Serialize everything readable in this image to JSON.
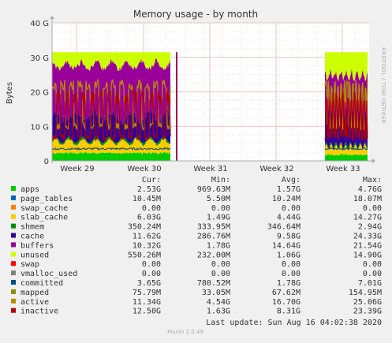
{
  "chart_data": {
    "type": "area",
    "title": "Memory usage - by month",
    "ylabel": "Bytes",
    "ylim": [
      0,
      40
    ],
    "y_unit": "G",
    "yticks": [
      "0",
      "10 G",
      "20 G",
      "30 G",
      "40 G"
    ],
    "categories": [
      "Week 29",
      "Week 30",
      "Week 31",
      "Week 32",
      "Week 33"
    ],
    "side_label": "RRDTOOL / TOBI OETIKER",
    "stack_levels_G": {
      "segment_1": {
        "apps": 2.0,
        "page_tables_to_slab": 5.5,
        "shmem": 5.8,
        "cache": 13.0,
        "buffers": 30.0,
        "unused": 31.5
      },
      "segment_2": {
        "apps": 1.5,
        "page_tables_to_slab": 4.0,
        "shmem": 4.3,
        "cache": 14.0,
        "buffers": 27.0,
        "unused": 31.5
      }
    },
    "line_series": {
      "committed": 3.5,
      "mapped": 0.1,
      "active_range": [
        9.0,
        23.5
      ],
      "inactive_range": [
        6.0,
        20.5
      ]
    },
    "legend_headers": [
      "Cur:",
      "Min:",
      "Avg:",
      "Max:"
    ],
    "legend": [
      {
        "name": "apps",
        "color": "#00cc00",
        "cur": "2.53G",
        "min": "969.63M",
        "avg": "1.57G",
        "max": "4.76G"
      },
      {
        "name": "page_tables",
        "color": "#0066b3",
        "cur": "10.45M",
        "min": "5.50M",
        "avg": "10.24M",
        "max": "18.07M"
      },
      {
        "name": "swap_cache",
        "color": "#ff8000",
        "cur": "0.00",
        "min": "0.00",
        "avg": "0.00",
        "max": "0.00"
      },
      {
        "name": "slab_cache",
        "color": "#ffcc00",
        "cur": "6.03G",
        "min": "1.49G",
        "avg": "4.44G",
        "max": "14.27G"
      },
      {
        "name": "shmem",
        "color": "#008f00",
        "cur": "350.24M",
        "min": "333.95M",
        "avg": "346.64M",
        "max": "2.94G"
      },
      {
        "name": "cache",
        "color": "#330099",
        "cur": "11.62G",
        "min": "286.76M",
        "avg": "9.58G",
        "max": "24.33G"
      },
      {
        "name": "buffers",
        "color": "#990099",
        "cur": "10.32G",
        "min": "1.78G",
        "avg": "14.64G",
        "max": "21.54G"
      },
      {
        "name": "unused",
        "color": "#ccff00",
        "cur": "550.26M",
        "min": "232.00M",
        "avg": "1.06G",
        "max": "14.90G"
      },
      {
        "name": "swap",
        "color": "#ff0000",
        "cur": "0.00",
        "min": "0.00",
        "avg": "0.00",
        "max": "0.00"
      },
      {
        "name": "vmalloc_used",
        "color": "#808080",
        "cur": "0.00",
        "min": "0.00",
        "avg": "0.00",
        "max": "0.00"
      },
      {
        "name": "committed",
        "color": "#004d80",
        "cur": "3.65G",
        "min": "780.52M",
        "avg": "1.78G",
        "max": "7.01G"
      },
      {
        "name": "mapped",
        "color": "#8c8c00",
        "cur": "75.79M",
        "min": "33.05M",
        "avg": "67.62M",
        "max": "154.95M"
      },
      {
        "name": "active",
        "color": "#b38c00",
        "cur": "11.34G",
        "min": "4.54G",
        "avg": "16.70G",
        "max": "25.06G"
      },
      {
        "name": "inactive",
        "color": "#b30000",
        "cur": "12.50G",
        "min": "1.63G",
        "avg": "8.31G",
        "max": "23.39G"
      }
    ]
  },
  "footer": {
    "last_update": "Last update: Sun Aug 16 04:02:38 2020",
    "version": "Munin 2.0.49"
  }
}
